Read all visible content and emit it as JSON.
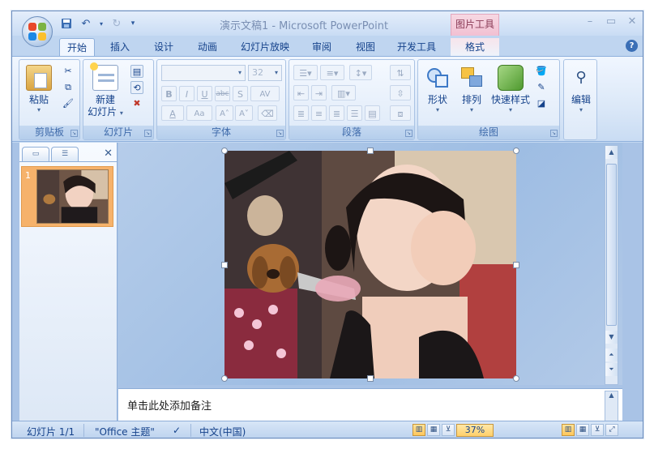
{
  "app": {
    "title": "演示文稿1 - Microsoft PowerPoint",
    "contextual_group": "图片工具"
  },
  "qat": {
    "save_icon": "save-icon",
    "undo_icon": "undo-icon",
    "redo_icon": "redo-icon"
  },
  "window_controls": {
    "minimize": "–",
    "maximize": "▭",
    "close": "✕"
  },
  "tabs": [
    "开始",
    "插入",
    "设计",
    "动画",
    "幻灯片放映",
    "审阅",
    "视图",
    "开发工具",
    "格式"
  ],
  "active_tab": "开始",
  "ribbon": {
    "clipboard": {
      "label": "剪贴板",
      "paste": "粘贴"
    },
    "slides": {
      "label": "幻灯片",
      "new_slide_line1": "新建",
      "new_slide_line2": "幻灯片"
    },
    "font": {
      "label": "字体",
      "size_value": "32",
      "bold": "B",
      "italic": "I",
      "underline": "U",
      "strike": "abc",
      "shadow": "S",
      "spacing": "AV",
      "color": "A",
      "case": "Aa",
      "grow": "A˄",
      "shrink": "A˅",
      "clear": "⌫"
    },
    "paragraph": {
      "label": "段落"
    },
    "drawing": {
      "label": "绘图",
      "shapes": "形状",
      "arrange": "排列",
      "quick_styles": "快速样式"
    },
    "editing": {
      "label": "编辑"
    }
  },
  "left_pane": {
    "slide_number": "1",
    "close_symbol": "✕"
  },
  "notes": {
    "placeholder": "单击此处添加备注"
  },
  "status": {
    "slide_info": "幻灯片 1/1",
    "theme": "\"Office 主题\"",
    "language": "中文(中国)",
    "zoom": "37%"
  },
  "colors": {
    "accent": "#15428b",
    "ribbon_bg": "#dbe8f8",
    "selected_thumb": "#f6b26b",
    "contextual_tab": "#f1c0d2"
  }
}
